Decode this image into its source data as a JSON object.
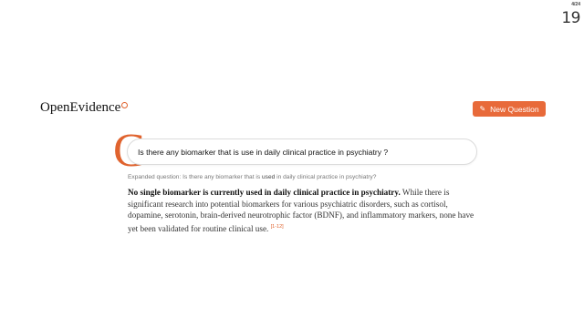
{
  "slide": {
    "counter": "4/24",
    "number": "19"
  },
  "header": {
    "logo_text": "OpenEvidence",
    "new_question_label": "New Question",
    "new_question_icon": "pencil-icon",
    "accent": "#e86a3a"
  },
  "brand": {
    "mark": "C"
  },
  "search": {
    "query": "Is there any biomarker that is use in daily clinical practice in psychiatry ?"
  },
  "expanded": {
    "prefix": "Expanded question: Is there any biomarker that is",
    "emphasis": "used",
    "suffix": "in daily clinical practice in psychiatry?"
  },
  "answer": {
    "bold": "No single biomarker is currently used in daily clinical practice in psychiatry.",
    "text": "While there is significant research into potential biomarkers for various psychiatric disorders, such as cortisol, dopamine, serotonin, brain-derived neurotrophic factor (BDNF), and inflammatory markers, none have yet been validated for routine clinical use.",
    "citation": "[1-12]"
  }
}
